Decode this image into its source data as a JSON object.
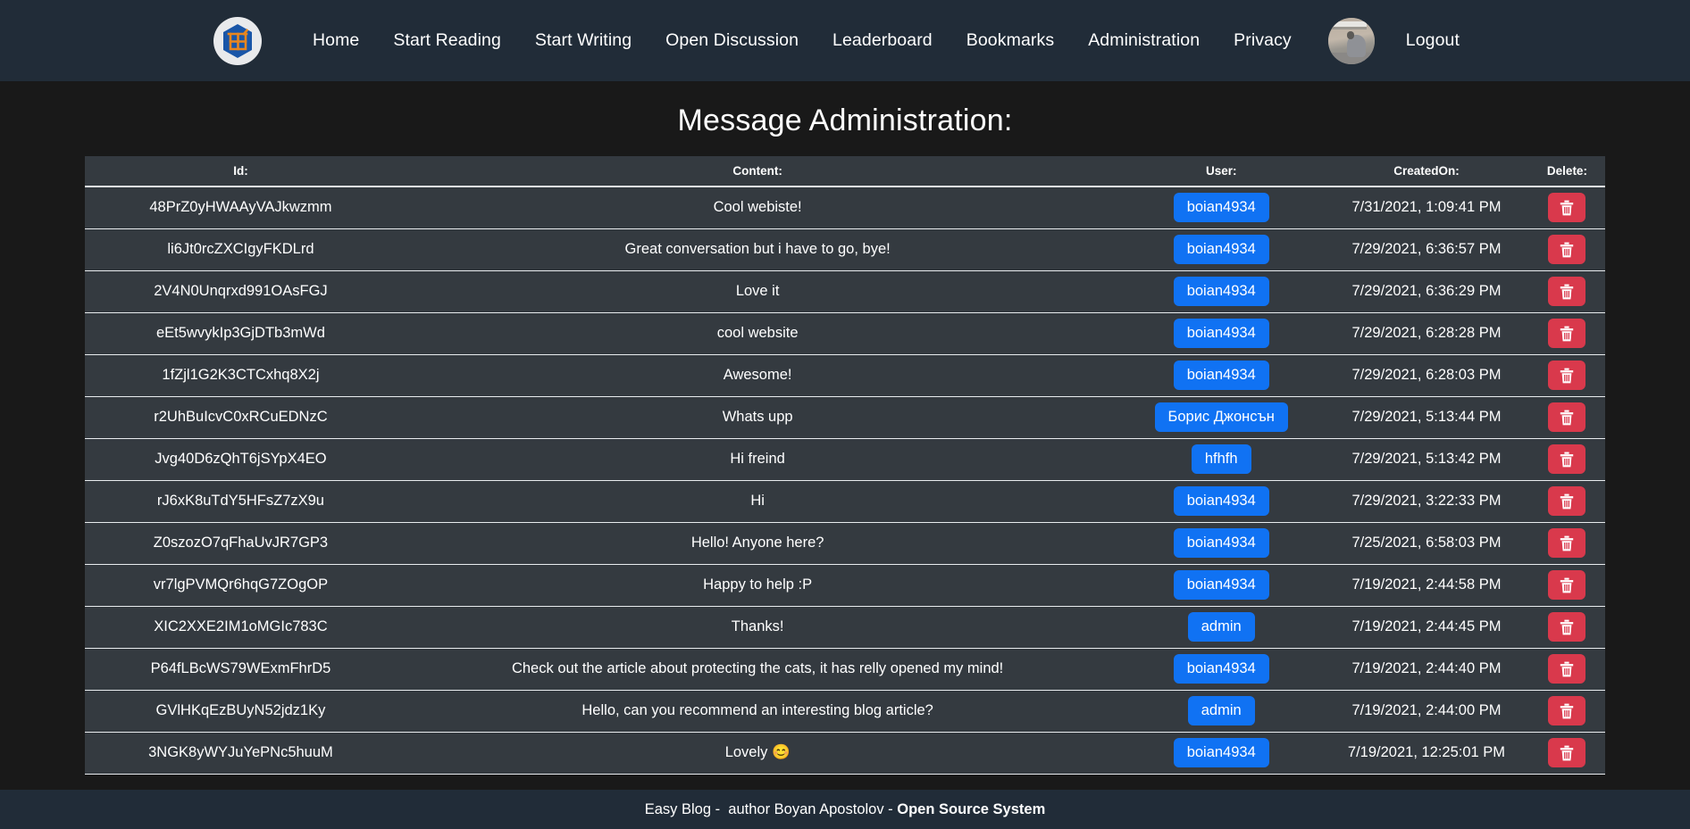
{
  "navbar": {
    "logo_name": "easy-blog-logo",
    "links": [
      "Home",
      "Start Reading",
      "Start Writing",
      "Open Discussion",
      "Leaderboard",
      "Bookmarks",
      "Administration",
      "Privacy"
    ],
    "logout_label": "Logout",
    "avatar_name": "user-avatar"
  },
  "page": {
    "title": "Message Administration:"
  },
  "table": {
    "headers": {
      "id": "Id:",
      "content": "Content:",
      "user": "User:",
      "created_on": "CreatedOn:",
      "delete": "Delete:"
    },
    "rows": [
      {
        "id": "48PrZ0yHWAAyVAJkwzmm",
        "content": "Cool webiste!",
        "user": "boian4934",
        "created_on": "7/31/2021, 1:09:41 PM",
        "delete_label": ""
      },
      {
        "id": "li6Jt0rcZXCIgyFKDLrd",
        "content": "Great conversation but i have to go, bye!",
        "user": "boian4934",
        "created_on": "7/29/2021, 6:36:57 PM",
        "delete_label": ""
      },
      {
        "id": "2V4N0Unqrxd991OAsFGJ",
        "content": "Love it",
        "user": "boian4934",
        "created_on": "7/29/2021, 6:36:29 PM",
        "delete_label": ""
      },
      {
        "id": "eEt5wvykIp3GjDTb3mWd",
        "content": "cool website",
        "user": "boian4934",
        "created_on": "7/29/2021, 6:28:28 PM",
        "delete_label": ""
      },
      {
        "id": "1fZjl1G2K3CTCxhq8X2j",
        "content": "Awesome!",
        "user": "boian4934",
        "created_on": "7/29/2021, 6:28:03 PM",
        "delete_label": ""
      },
      {
        "id": "r2UhBuIcvC0xRCuEDNzC",
        "content": "Whats upp",
        "user": "Борис Джонсън",
        "created_on": "7/29/2021, 5:13:44 PM",
        "delete_label": ""
      },
      {
        "id": "Jvg40D6zQhT6jSYpX4EO",
        "content": "Hi freind",
        "user": "hfhfh",
        "created_on": "7/29/2021, 5:13:42 PM",
        "delete_label": ""
      },
      {
        "id": "rJ6xK8uTdY5HFsZ7zX9u",
        "content": "Hi",
        "user": "boian4934",
        "created_on": "7/29/2021, 3:22:33 PM",
        "delete_label": ""
      },
      {
        "id": "Z0szozO7qFhaUvJR7GP3",
        "content": "Hello! Anyone here?",
        "user": "boian4934",
        "created_on": "7/25/2021, 6:58:03 PM",
        "delete_label": ""
      },
      {
        "id": "vr7lgPVMQr6hqG7ZOgOP",
        "content": "Happy to help :P",
        "user": "boian4934",
        "created_on": "7/19/2021, 2:44:58 PM",
        "delete_label": ""
      },
      {
        "id": "XIC2XXE2IM1oMGIc783C",
        "content": "Thanks!",
        "user": "admin",
        "created_on": "7/19/2021, 2:44:45 PM",
        "delete_label": ""
      },
      {
        "id": "P64fLBcWS79WExmFhrD5",
        "content": "Check out the article about protecting the cats, it has relly opened my mind!",
        "user": "boian4934",
        "created_on": "7/19/2021, 2:44:40 PM",
        "delete_label": ""
      },
      {
        "id": "GVlHKqEzBUyN52jdz1Ky",
        "content": "Hello, can you recommend an interesting blog article?",
        "user": "admin",
        "created_on": "7/19/2021, 2:44:00 PM",
        "delete_label": ""
      },
      {
        "id": "3NGK8yWYJuYePNc5huuM",
        "content": "Lovely 😊",
        "user": "boian4934",
        "created_on": "7/19/2021, 12:25:01 PM",
        "delete_label": ""
      }
    ]
  },
  "footer": {
    "site_name": "Easy Blog",
    "separator_1": " -  ",
    "author": "author Boyan Apostolov",
    "separator_2": " - ",
    "system": "Open Source System"
  },
  "colors": {
    "navbar_bg": "#212c38",
    "page_bg": "#191919",
    "table_bg": "#343a40",
    "badge_blue": "#1072f3",
    "delete_red": "#d9394c",
    "logo_blue": "#1a56a8",
    "logo_orange": "#e8861f",
    "text": "#ffffff"
  }
}
